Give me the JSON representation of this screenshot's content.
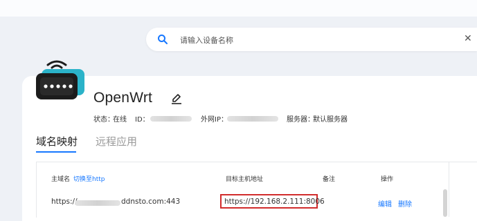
{
  "search": {
    "placeholder": "请输入设备名称",
    "clear_icon": "close-icon",
    "search_icon": "search-icon"
  },
  "device": {
    "name": "OpenWrt",
    "status_label": "状态：",
    "status_value": "在线",
    "id_label": "ID：",
    "wan_ip_label": "外网IP：",
    "server_label": "服务器：",
    "server_value": "默认服务器"
  },
  "tabs": [
    {
      "label": "域名映射",
      "active": true
    },
    {
      "label": "远程应用",
      "active": false
    }
  ],
  "table": {
    "headers": {
      "host": "主域名",
      "switch_http": "切换至http",
      "target": "目标主机地址",
      "note": "备注",
      "actions": "操作"
    },
    "rows": [
      {
        "host_prefix": "https://",
        "host_suffix": "ddnsto.com:443",
        "target": "https://192.168.2.111:8006",
        "note": "",
        "edit": "编辑",
        "delete": "删除"
      }
    ]
  },
  "colors": {
    "accent": "#1677ff",
    "highlight_border": "#d12b2b",
    "router_teal": "#2bb3c9"
  }
}
